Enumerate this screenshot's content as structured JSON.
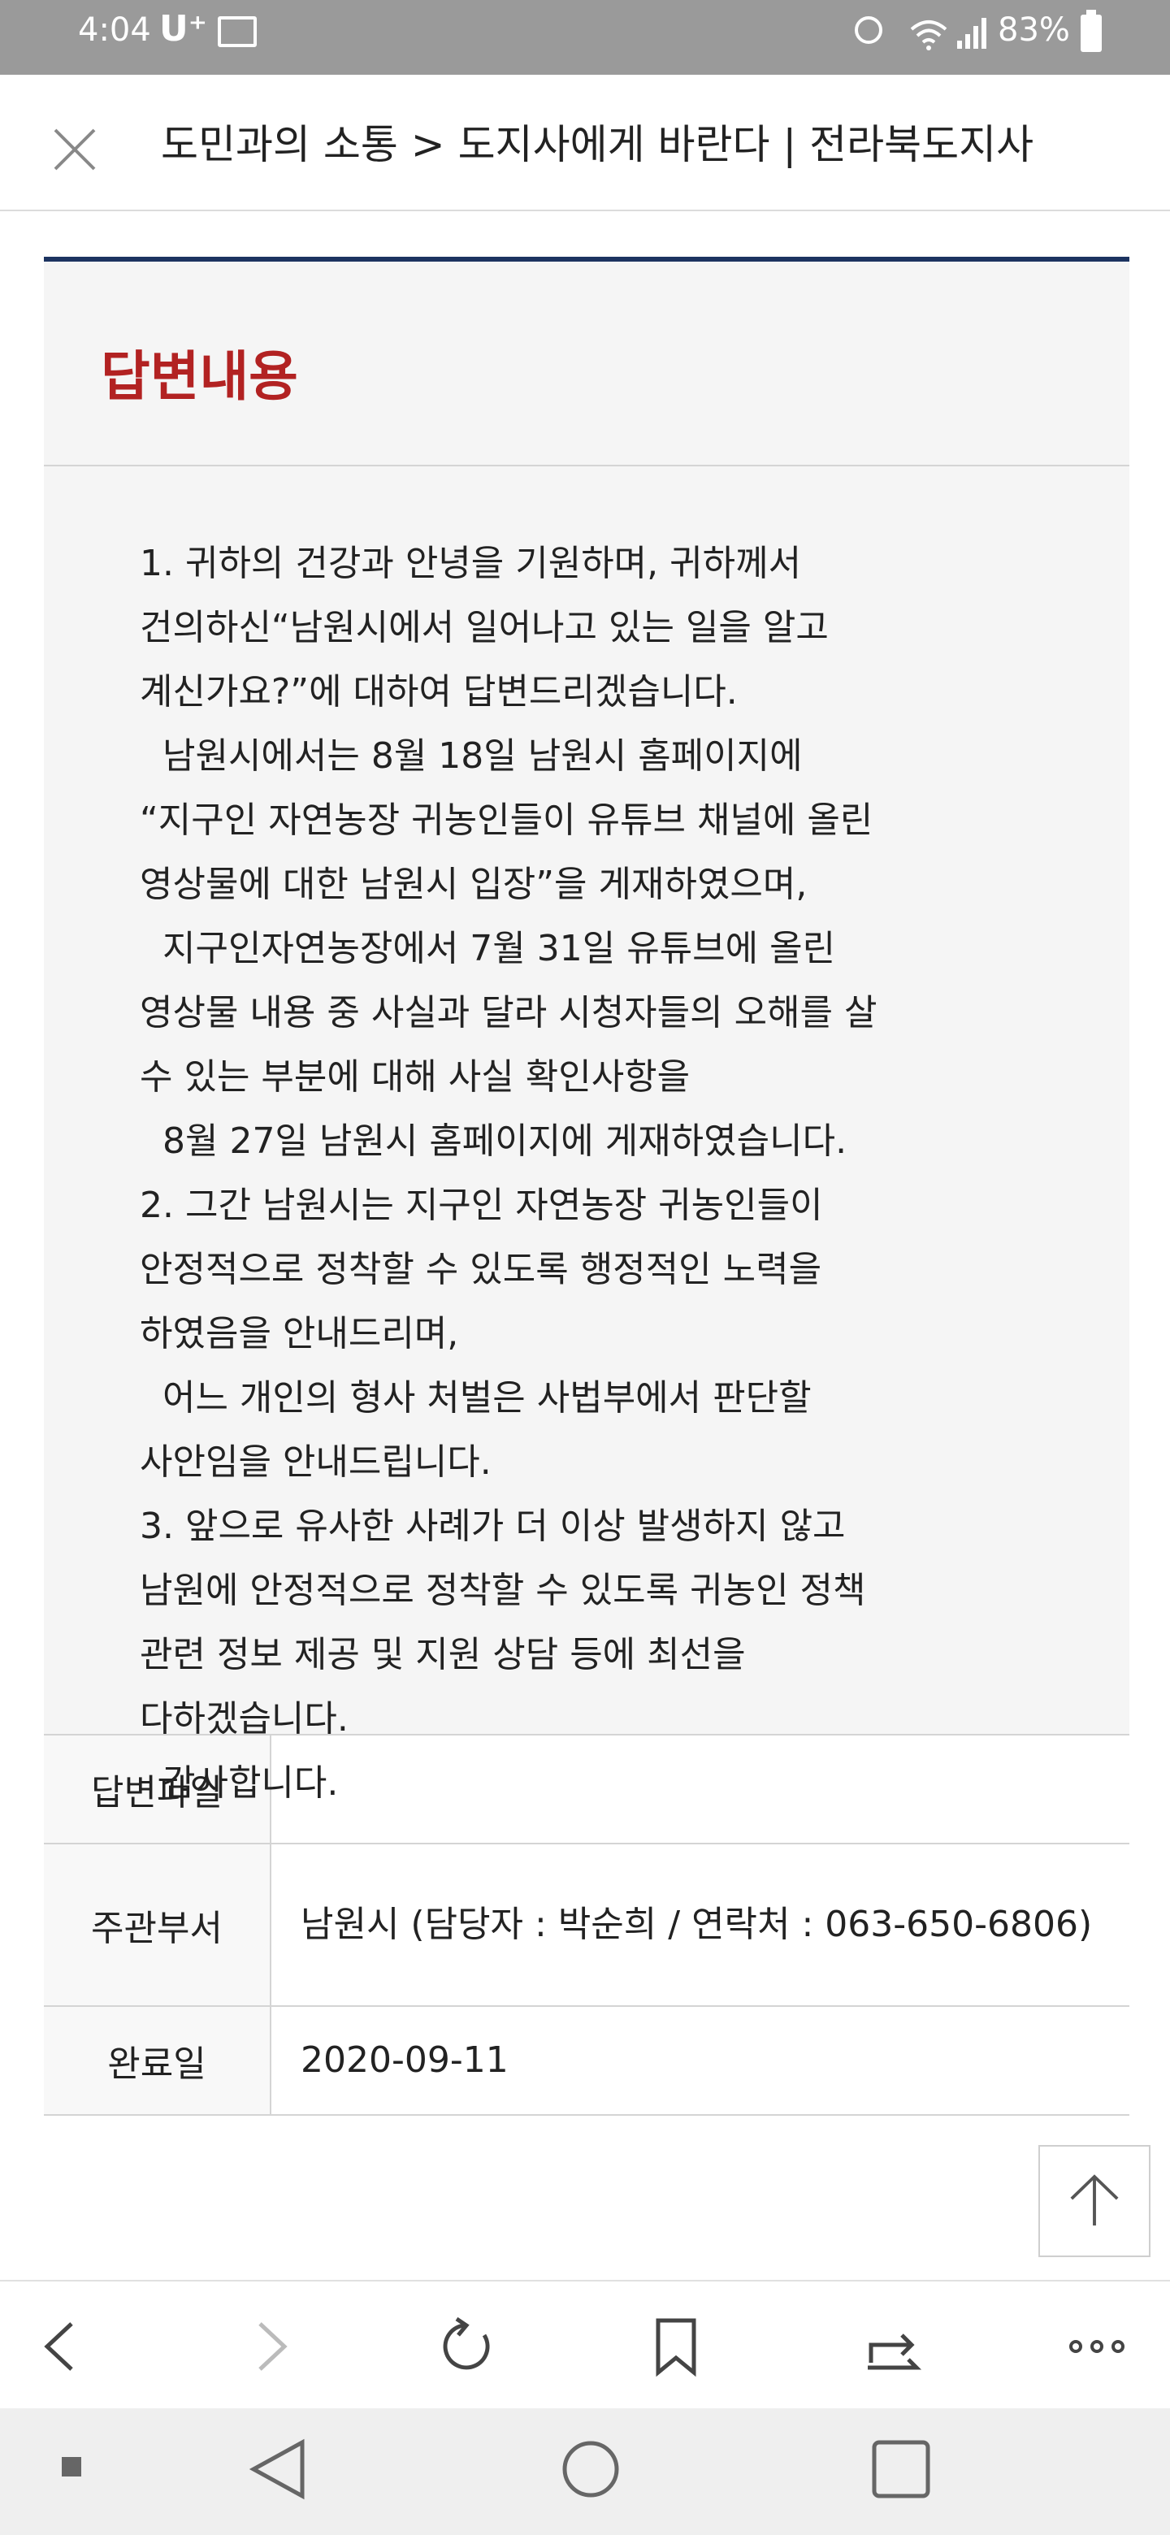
{
  "status_bar": {
    "time": "4:04",
    "carrier": "U⁺",
    "battery": "83%"
  },
  "title_bar": {
    "title": "도민과의 소통 > 도지사에게 바란다 | 전라북도지사"
  },
  "answer": {
    "heading": "답변내용",
    "lines": [
      "1. 귀하의 건강과 안녕을 기원하며, 귀하께서",
      "건의하신“남원시에서 일어나고 있는 일을 알고",
      "계신가요?”에 대하여 답변드리겠습니다.",
      "  남원시에서는 8월 18일 남원시 홈페이지에",
      "“지구인 자연농장 귀농인들이 유튜브 채널에 올린",
      "영상물에 대한 남원시 입장”을 게재하였으며,",
      "  지구인자연농장에서 7월 31일 유튜브에 올린",
      "영상물 내용 중 사실과 달라 시청자들의 오해를 살",
      "수 있는 부분에 대해 사실 확인사항을",
      "  8월 27일 남원시 홈페이지에 게재하였습니다.",
      "2. 그간 남원시는 지구인 자연농장 귀농인들이",
      "안정적으로 정착할 수 있도록 행정적인 노력을",
      "하였음을 안내드리며,",
      "  어느 개인의 형사 처벌은 사법부에서 판단할",
      "사안임을 안내드립니다.",
      "3. 앞으로 유사한 사례가 더 이상 발생하지 않고",
      "남원에 안정적으로 정착할 수 있도록 귀농인 정책",
      "관련 정보 제공 및 지원 상담 등에 최선을",
      "다하겠습니다.",
      "  감사합니다."
    ]
  },
  "info": {
    "file_label": "답변파일",
    "file_value": "",
    "dept_label": "주관부서",
    "dept_value": "남원시 (담당자 : 박순희 / 연락처 : 063-650-6806)",
    "date_label": "완료일",
    "date_value": "2020-09-11"
  },
  "icons": {
    "close": "close-icon",
    "top": "arrow-up-icon",
    "back": "chevron-left-icon",
    "forward": "chevron-right-icon",
    "reload": "reload-icon",
    "bookmark": "bookmark-icon",
    "share": "share-icon",
    "more": "more-icon"
  }
}
